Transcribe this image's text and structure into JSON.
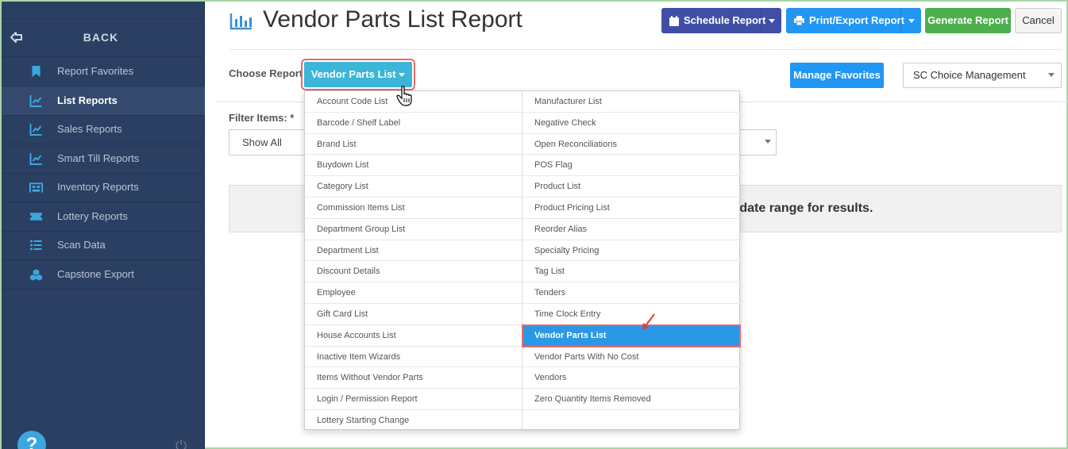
{
  "sidebar": {
    "back_label": "BACK",
    "items": [
      {
        "label": "Report Favorites",
        "icon": "bookmark-icon",
        "active": false
      },
      {
        "label": "List Reports",
        "icon": "chart-line-icon",
        "active": true
      },
      {
        "label": "Sales Reports",
        "icon": "chart-line-icon",
        "active": false
      },
      {
        "label": "Smart Till Reports",
        "icon": "chart-line-icon",
        "active": false
      },
      {
        "label": "Inventory Reports",
        "icon": "warehouse-icon",
        "active": false
      },
      {
        "label": "Lottery Reports",
        "icon": "ticket-icon",
        "active": false
      },
      {
        "label": "Scan Data",
        "icon": "list-icon",
        "active": false
      },
      {
        "label": "Capstone Export",
        "icon": "cubes-icon",
        "active": false
      }
    ],
    "help_label": "?"
  },
  "header": {
    "title": "Vendor Parts List Report",
    "schedule_label": "Schedule Report",
    "print_label": "Print/Export Report",
    "generate_label": "Generate Report",
    "cancel_label": "Cancel"
  },
  "choose": {
    "label": "Choose Report",
    "selected": "Vendor Parts List",
    "manage_favorites": "Manage Favorites",
    "store": "SC Choice Management"
  },
  "filter": {
    "label": "Filter Items: *",
    "value": "Show All"
  },
  "info_message": "e date range for results.",
  "dropdown": {
    "col1": [
      "Account Code List",
      "Barcode / Shelf Label",
      "Brand List",
      "Buydown List",
      "Category List",
      "Commission Items List",
      "Department Group List",
      "Department List",
      "Discount Details",
      "Employee",
      "Gift Card List",
      "House Accounts List",
      "Inactive Item Wizards",
      "Items Without Vendor Parts",
      "Login / Permission Report",
      "Lottery Starting Change"
    ],
    "col2": [
      "Manufacturer List",
      "Negative Check",
      "Open Reconciliations",
      "POS Flag",
      "Product List",
      "Product Pricing List",
      "Reorder Alias",
      "Specialty Pricing",
      "Tag List",
      "Tenders",
      "Time Clock Entry",
      "Vendor Parts List",
      "Vendor Parts With No Cost",
      "Vendors",
      "Zero Quantity Items Removed"
    ],
    "selected": "Vendor Parts List"
  },
  "colors": {
    "sidebar_bg": "#2b3f62",
    "schedule": "#3f4fa8",
    "print": "#2196f3",
    "generate": "#4cae4c",
    "selected_report": "#3bb5d8",
    "highlight": "#e46a6a"
  }
}
